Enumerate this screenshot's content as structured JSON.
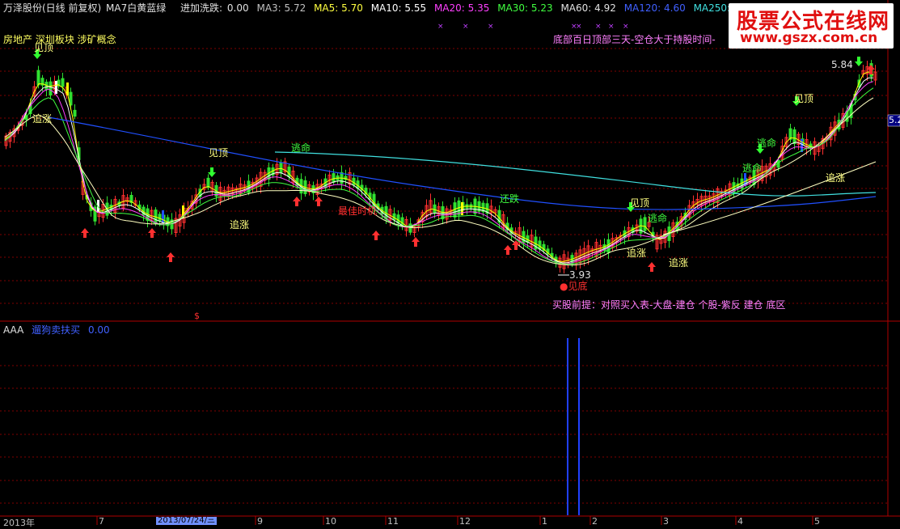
{
  "header": {
    "stock_title": "万泽股份(日线 前复权)",
    "indicator_name": "MA7白黄蓝绿",
    "jiajia_label": "进加洗跌:",
    "jiajia_value": "0.00",
    "ma3": "MA3: 5.72",
    "ma5": "MA5: 5.70",
    "ma10": "MA10: 5.55",
    "ma20": "MA20: 5.35",
    "ma30": "MA30: 5.23",
    "ma60": "MA60: 4.92",
    "ma120": "MA120: 4.60",
    "ma250": "MA250: 4.66"
  },
  "colors": {
    "ma3": "#ffffff",
    "ma5": "#ffff00",
    "ma10": "#ffffff",
    "ma20": "#ff40ff",
    "ma30": "#40ff40",
    "ma60": "#ffffff",
    "ma120": "#2050ff",
    "ma250": "#40e0e0",
    "up": "#ff3030",
    "down": "#30e030",
    "grid": "#800000"
  },
  "sectors": "房地产 深圳板块 涉矿概念",
  "top_right_note": "底部百日顶部三天-空仓大于持股时间-",
  "buy_hint": "买股前提：对照买入表-大盘-建仓  个股-紫反 建仓 底区",
  "price_labels": {
    "high": "5.84",
    "low": "3.93",
    "right_axis": "5.2"
  },
  "annotations": {
    "jianding": "见顶",
    "zhuizhang": "追涨",
    "taoming": "逃命",
    "zuijia": "最佳时机",
    "jiandi": "●见底",
    "huanjia": "还跌"
  },
  "sub_panel": {
    "name": "AAA",
    "indicator": "遛狗卖扶买",
    "value": "0.00"
  },
  "x_axis": {
    "year_label": "2013年",
    "months": [
      "7",
      "9",
      "10",
      "11",
      "12",
      "1",
      "2",
      "3",
      "4",
      "5"
    ],
    "selected_date": "2013/07/24/三"
  }
}
